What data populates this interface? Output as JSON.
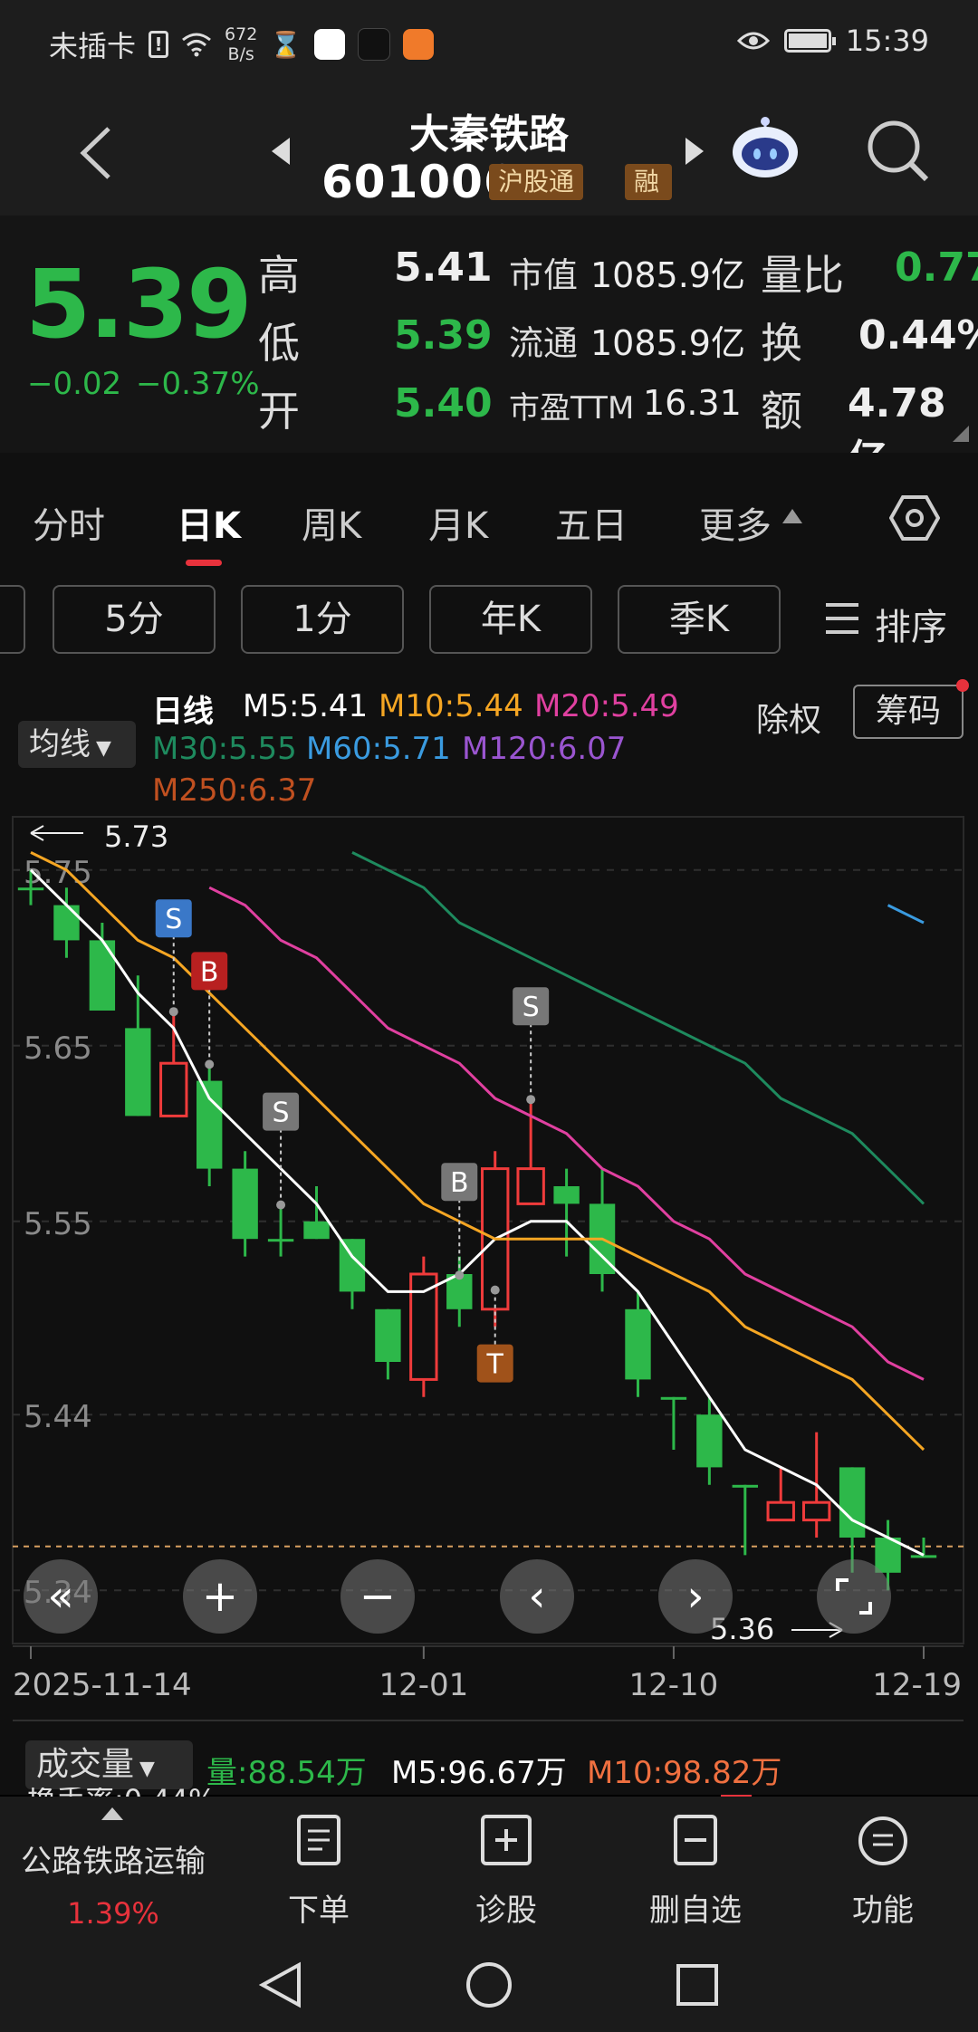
{
  "status_bar": {
    "carrier": "未插卡",
    "net_speed_value": "672",
    "net_speed_unit": "B/s",
    "time": "15:39"
  },
  "header": {
    "title": "大秦铁路",
    "code": "601006",
    "tags": [
      "沪股通",
      "融"
    ]
  },
  "quote": {
    "price": "5.39",
    "change": "−0.02",
    "change_pct": "−0.37%",
    "rows": [
      {
        "label": "高",
        "value": "5.41",
        "mid_label": "市值",
        "mid_value": "1085.9亿",
        "right_label": "量比",
        "right_value": "0.77"
      },
      {
        "label": "低",
        "value": "5.39",
        "mid_label": "流通",
        "mid_value": "1085.9亿",
        "right_label": "换",
        "right_value": "0.44%"
      },
      {
        "label": "开",
        "value": "5.40",
        "mid_label": "市盈TTM",
        "mid_value": "16.31",
        "right_label": "额",
        "right_value": "4.78亿"
      }
    ]
  },
  "tabs": [
    "分时",
    "日K",
    "周K",
    "月K",
    "五日",
    "更多"
  ],
  "active_tab": "日K",
  "sub_tabs": [
    "5分",
    "1分",
    "年K",
    "季K",
    "排序"
  ],
  "chart": {
    "ma_selector": "均线",
    "period_label": "日线",
    "ma": [
      {
        "name": "M5",
        "value": "5.41",
        "color": "#ffffff"
      },
      {
        "name": "M10",
        "value": "5.44",
        "color": "#f5a623"
      },
      {
        "name": "M20",
        "value": "5.49",
        "color": "#e040a0"
      },
      {
        "name": "M30",
        "value": "5.55",
        "color": "#1e8a5e"
      },
      {
        "name": "M60",
        "value": "5.71",
        "color": "#3a9be0"
      },
      {
        "name": "M120",
        "value": "6.07",
        "color": "#9a55d0"
      },
      {
        "name": "M250",
        "value": "6.37",
        "color": "#c05020"
      }
    ],
    "ex_rights": "除权",
    "chips": "筹码",
    "y_ticks": [
      "5.75",
      "5.65",
      "5.55",
      "5.44",
      "5.34"
    ],
    "high_marker": "5.73",
    "low_marker": "5.36",
    "x_ticks": [
      "2025-11-14",
      "12-01",
      "12-10",
      "12-19"
    ],
    "signals": [
      "S",
      "B",
      "S",
      "B",
      "S",
      "T"
    ]
  },
  "chart_data": {
    "type": "candlestick",
    "title": "",
    "ylim": [
      5.32,
      5.77
    ],
    "x": [
      "11-14",
      "11-17",
      "11-18",
      "11-19",
      "11-20",
      "11-21",
      "11-24",
      "11-25",
      "11-26",
      "11-27",
      "11-28",
      "12-01",
      "12-02",
      "12-03",
      "12-04",
      "12-05",
      "12-08",
      "12-09",
      "12-10",
      "12-11",
      "12-12",
      "12-15",
      "12-16",
      "12-17",
      "12-18",
      "12-19"
    ],
    "candles": [
      {
        "o": 5.74,
        "h": 5.75,
        "l": 5.73,
        "c": 5.74
      },
      {
        "o": 5.73,
        "h": 5.74,
        "l": 5.7,
        "c": 5.71
      },
      {
        "o": 5.71,
        "h": 5.72,
        "l": 5.67,
        "c": 5.67
      },
      {
        "o": 5.66,
        "h": 5.69,
        "l": 5.61,
        "c": 5.61
      },
      {
        "o": 5.61,
        "h": 5.67,
        "l": 5.61,
        "c": 5.64
      },
      {
        "o": 5.63,
        "h": 5.64,
        "l": 5.57,
        "c": 5.58
      },
      {
        "o": 5.58,
        "h": 5.59,
        "l": 5.53,
        "c": 5.54
      },
      {
        "o": 5.54,
        "h": 5.56,
        "l": 5.53,
        "c": 5.54
      },
      {
        "o": 5.55,
        "h": 5.57,
        "l": 5.54,
        "c": 5.54
      },
      {
        "o": 5.54,
        "h": 5.54,
        "l": 5.5,
        "c": 5.51
      },
      {
        "o": 5.5,
        "h": 5.5,
        "l": 5.46,
        "c": 5.47
      },
      {
        "o": 5.46,
        "h": 5.53,
        "l": 5.45,
        "c": 5.52
      },
      {
        "o": 5.52,
        "h": 5.53,
        "l": 5.49,
        "c": 5.5
      },
      {
        "o": 5.5,
        "h": 5.59,
        "l": 5.49,
        "c": 5.58
      },
      {
        "o": 5.56,
        "h": 5.62,
        "l": 5.56,
        "c": 5.58
      },
      {
        "o": 5.57,
        "h": 5.58,
        "l": 5.53,
        "c": 5.56
      },
      {
        "o": 5.56,
        "h": 5.58,
        "l": 5.51,
        "c": 5.52
      },
      {
        "o": 5.5,
        "h": 5.51,
        "l": 5.45,
        "c": 5.46
      },
      {
        "o": 5.45,
        "h": 5.45,
        "l": 5.42,
        "c": 5.45
      },
      {
        "o": 5.44,
        "h": 5.45,
        "l": 5.4,
        "c": 5.41
      },
      {
        "o": 5.4,
        "h": 5.4,
        "l": 5.36,
        "c": 5.4
      },
      {
        "o": 5.38,
        "h": 5.41,
        "l": 5.38,
        "c": 5.39
      },
      {
        "o": 5.38,
        "h": 5.43,
        "l": 5.37,
        "c": 5.39
      },
      {
        "o": 5.41,
        "h": 5.41,
        "l": 5.35,
        "c": 5.37
      },
      {
        "o": 5.37,
        "h": 5.38,
        "l": 5.34,
        "c": 5.35
      },
      {
        "o": 5.36,
        "h": 5.37,
        "l": 5.36,
        "c": 5.36
      }
    ],
    "ma_lines": {
      "M5": [
        5.75,
        5.73,
        5.71,
        5.68,
        5.66,
        5.62,
        5.6,
        5.58,
        5.56,
        5.53,
        5.51,
        5.51,
        5.52,
        5.54,
        5.55,
        5.55,
        5.53,
        5.51,
        5.48,
        5.45,
        5.42,
        5.41,
        5.4,
        5.38,
        5.37,
        5.36
      ],
      "M10": [
        5.76,
        5.75,
        5.73,
        5.71,
        5.7,
        5.68,
        5.66,
        5.64,
        5.62,
        5.6,
        5.58,
        5.56,
        5.55,
        5.54,
        5.54,
        5.54,
        5.54,
        5.53,
        5.52,
        5.51,
        5.49,
        5.48,
        5.47,
        5.46,
        5.44,
        5.42
      ],
      "M20": [
        null,
        null,
        null,
        null,
        null,
        5.74,
        5.73,
        5.71,
        5.7,
        5.68,
        5.66,
        5.65,
        5.64,
        5.62,
        5.61,
        5.6,
        5.58,
        5.57,
        5.55,
        5.54,
        5.52,
        5.51,
        5.5,
        5.49,
        5.47,
        5.46
      ],
      "M30": [
        null,
        null,
        null,
        null,
        null,
        null,
        null,
        null,
        null,
        5.76,
        5.75,
        5.74,
        5.72,
        5.71,
        5.7,
        5.69,
        5.68,
        5.67,
        5.66,
        5.65,
        5.64,
        5.62,
        5.61,
        5.6,
        5.58,
        5.56
      ],
      "M60": [
        null,
        null,
        null,
        null,
        null,
        null,
        null,
        null,
        null,
        null,
        null,
        null,
        null,
        null,
        null,
        null,
        null,
        null,
        null,
        null,
        null,
        null,
        null,
        null,
        5.73,
        5.72
      ]
    }
  },
  "volume": {
    "selector": "成交量",
    "vol": "量:88.54万",
    "m5": "M5:96.67万",
    "m10": "M10:98.82万",
    "turnover_partial": "换手率:0.44%"
  },
  "bottom": {
    "sector": "公路铁路运输",
    "sector_change": "1.39%",
    "items": [
      "下单",
      "诊股",
      "删自选",
      "功能"
    ]
  }
}
